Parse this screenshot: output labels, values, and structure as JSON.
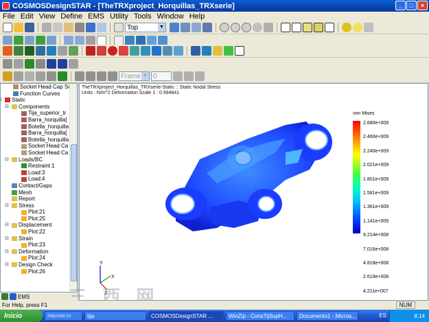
{
  "window": {
    "title": "COSMOSDesignSTAR - [TheTRXproject_Horquillas_TRXserie]",
    "controls": [
      "_",
      "□",
      "×"
    ]
  },
  "menu": [
    "File",
    "Edit",
    "View",
    "Define",
    "EMS",
    "Utility",
    "Tools",
    "Window",
    "Help"
  ],
  "toolbar": {
    "view_combo": "Top",
    "frame_combo": "Frame",
    "frame_value": "0"
  },
  "tree": {
    "items": [
      "Socket Head Cap Sc",
      "Function Curves",
      "Static",
      "Components",
      "Tija_superior_tr",
      "Barra_horquilla[",
      "Botella_horquilla",
      "Barra_horquilla[",
      "Botella_horquilla",
      "Socket Head Ca",
      "Socket Head Ca",
      "Loads/BC",
      "Restraint:1",
      "Load:3",
      "Load:4",
      "Contact/Gaps",
      "Mesh",
      "Report",
      "Stress",
      "Plot:21",
      "Plot:25",
      "Displacement",
      "Plot:22",
      "Strain",
      "Plot:23",
      "Deformation",
      "Plot:24",
      "Design Check",
      "Plot:26"
    ]
  },
  "sidetabs": [
    "EMS"
  ],
  "viewport": {
    "title_line1": "TheTRXproject_Horquillas_TRXserie-Static :: Static Nodal Stress",
    "title_line2": "Units : N/m^2   Deformation Scale  1 : 0.994841"
  },
  "legend": {
    "title": "von Mises",
    "values": [
      "2.680e+009",
      "2.460e+009",
      "2.240e+009",
      "2.021e+009",
      "1.801e+009",
      "1.581e+009",
      "1.361e+009",
      "1.141e+009",
      "9.214e+008",
      "7.016e+008",
      "4.818e+008",
      "2.619e+008",
      "4.211e+007"
    ]
  },
  "axis": {
    "x": "X",
    "y": "Y",
    "z": "Z"
  },
  "status": {
    "left": "For Help, press F1",
    "num": "NUM"
  },
  "taskbar": {
    "start": "Inicio",
    "tasks": [
      "",
      "tija",
      "COSMOSDesignSTAR ...",
      "WinZip - ConsTijSupH...",
      "Documento1 - Micros..."
    ],
    "lang": "ES",
    "time": "8:14"
  },
  "watermark": "三 西 网",
  "watermark_site": "3dportal.cn",
  "colors": {
    "accent": "#0a5fd8",
    "part": "#1a3cff",
    "legend_top": "#ff0000",
    "legend_bottom": "#0000c0"
  }
}
